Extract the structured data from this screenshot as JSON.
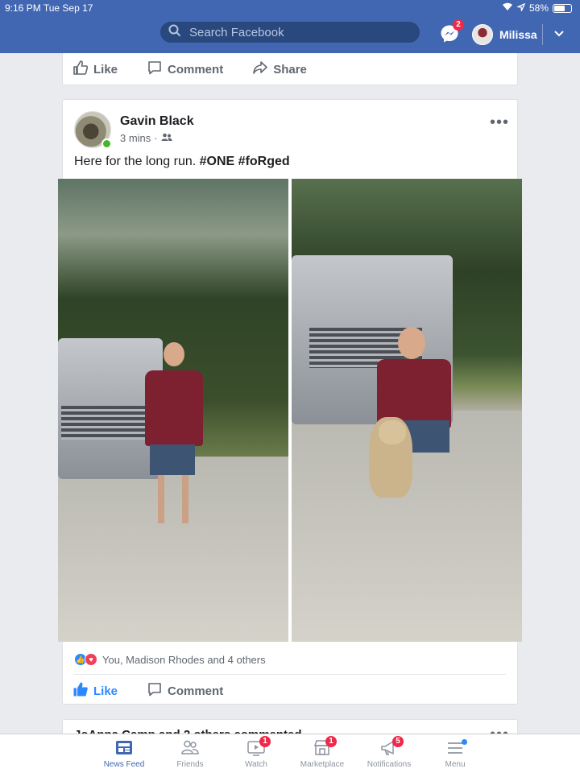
{
  "status_bar": {
    "time": "9:16 PM",
    "date": "Tue Sep 17",
    "battery": "58%"
  },
  "header": {
    "search_placeholder": "Search Facebook",
    "messenger_badge": "2",
    "profile_name": "Milissa"
  },
  "prev_post": {
    "like": "Like",
    "comment": "Comment",
    "share": "Share"
  },
  "post": {
    "author": "Gavin Black",
    "time": "3 mins",
    "text_plain": "Here for the long run. ",
    "hashtag1": "#ONE",
    "hashtag2": "#foRged",
    "reactions_text": "You, Madison Rhodes and 4 others",
    "like": "Like",
    "comment": "Comment"
  },
  "next_post": {
    "header": "JoAnna Camp and 2 others commented"
  },
  "bottom_nav": {
    "news_feed": "News Feed",
    "friends": "Friends",
    "watch": "Watch",
    "watch_badge": "1",
    "marketplace": "Marketplace",
    "marketplace_badge": "1",
    "notifications": "Notifications",
    "notifications_badge": "5",
    "menu": "Menu"
  },
  "colors": {
    "brand": "#4267b2",
    "like_blue": "#2d88ff",
    "badge_red": "#f02849",
    "online_green": "#42b72a"
  }
}
